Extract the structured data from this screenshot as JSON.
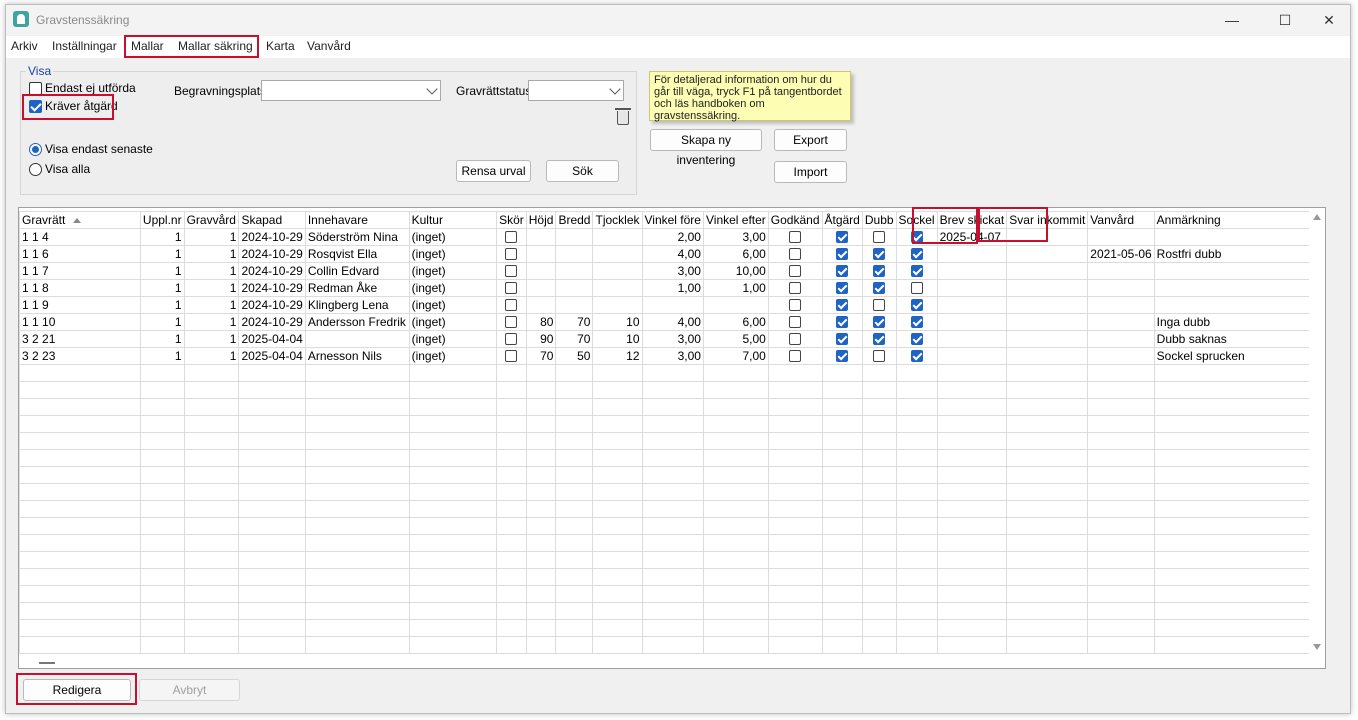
{
  "window": {
    "title": "Gravstenssäkring",
    "minimize": "—",
    "maximize": "☐",
    "close": "✕"
  },
  "menu": [
    "Arkiv",
    "Inställningar",
    "Mallar",
    "Mallar säkring",
    "Karta",
    "Vanvård"
  ],
  "filter": {
    "group_title": "Visa",
    "endast_ej_utforda": {
      "label": "Endast ej utförda",
      "checked": false
    },
    "kraver_atgard": {
      "label": "Kräver åtgärd",
      "checked": true
    },
    "visa_endast_senaste": {
      "label": "Visa endast senaste",
      "selected": true
    },
    "visa_alla": {
      "label": "Visa alla",
      "selected": false
    },
    "begravningsplats_label": "Begravningsplats:",
    "begravningsplats_value": "",
    "gravrattstatus_label": "Gravrättstatus:",
    "gravrattstatus_value": "",
    "rensa_urval": "Rensa urval",
    "sok": "Sök"
  },
  "help_note": "För detaljerad information om hur du går till väga, tryck F1 på tangentbordet och läs handboken om gravstenssäkring.",
  "actions": {
    "skapa_ny_inventering": "Skapa ny inventering",
    "export": "Export",
    "import": "Import"
  },
  "grid": {
    "columns": [
      "Gravrätt",
      "Uppl.nr",
      "Gravvård",
      "Skapad",
      "Innehavare",
      "Kultur",
      "Skör",
      "Höjd",
      "Bredd",
      "Tjocklek",
      "Vinkel före",
      "Vinkel efter",
      "Godkänd",
      "Åtgärd",
      "Dubb",
      "Sockel",
      "Brev skickat",
      "Svar inkommit",
      "Vanvård",
      "Anmärkning"
    ],
    "rows": [
      {
        "gravratt": "1 1  4",
        "uppl": "1",
        "gravvard": "1",
        "skapad": "2024-10-29",
        "innehavare": "Söderström Nina",
        "kultur": "(inget)",
        "skor": false,
        "hojd": "",
        "bredd": "",
        "tjocklek": "",
        "vinkel_fore": "2,00",
        "vinkel_efter": "3,00",
        "godkand": false,
        "atgard": true,
        "dubb": false,
        "sockel": true,
        "brev": "2025-04-07",
        "svar": "",
        "vanvard": "",
        "anm": ""
      },
      {
        "gravratt": "1 1  6",
        "uppl": "1",
        "gravvard": "1",
        "skapad": "2024-10-29",
        "innehavare": "Rosqvist Ella",
        "kultur": "(inget)",
        "skor": false,
        "hojd": "",
        "bredd": "",
        "tjocklek": "",
        "vinkel_fore": "4,00",
        "vinkel_efter": "6,00",
        "godkand": false,
        "atgard": true,
        "dubb": true,
        "sockel": true,
        "brev": "",
        "svar": "",
        "vanvard": "2021-05-06",
        "anm": "Rostfri dubb"
      },
      {
        "gravratt": "1 1  7",
        "uppl": "1",
        "gravvard": "1",
        "skapad": "2024-10-29",
        "innehavare": "Collin Edvard",
        "kultur": "(inget)",
        "skor": false,
        "hojd": "",
        "bredd": "",
        "tjocklek": "",
        "vinkel_fore": "3,00",
        "vinkel_efter": "10,00",
        "godkand": false,
        "atgard": true,
        "dubb": true,
        "sockel": true,
        "brev": "",
        "svar": "",
        "vanvard": "",
        "anm": ""
      },
      {
        "gravratt": "1 1  8",
        "uppl": "1",
        "gravvard": "1",
        "skapad": "2024-10-29",
        "innehavare": "Redman Åke",
        "kultur": "(inget)",
        "skor": false,
        "hojd": "",
        "bredd": "",
        "tjocklek": "",
        "vinkel_fore": "1,00",
        "vinkel_efter": "1,00",
        "godkand": false,
        "atgard": true,
        "dubb": true,
        "sockel": false,
        "brev": "",
        "svar": "",
        "vanvard": "",
        "anm": ""
      },
      {
        "gravratt": "1 1  9",
        "uppl": "1",
        "gravvard": "1",
        "skapad": "2024-10-29",
        "innehavare": "Klingberg Lena",
        "kultur": "(inget)",
        "skor": false,
        "hojd": "",
        "bredd": "",
        "tjocklek": "",
        "vinkel_fore": "",
        "vinkel_efter": "",
        "godkand": false,
        "atgard": true,
        "dubb": false,
        "sockel": true,
        "brev": "",
        "svar": "",
        "vanvard": "",
        "anm": ""
      },
      {
        "gravratt": "1 1  10",
        "uppl": "1",
        "gravvard": "1",
        "skapad": "2024-10-29",
        "innehavare": "Andersson Fredrik",
        "kultur": "(inget)",
        "skor": false,
        "hojd": "80",
        "bredd": "70",
        "tjocklek": "10",
        "vinkel_fore": "4,00",
        "vinkel_efter": "6,00",
        "godkand": false,
        "atgard": true,
        "dubb": true,
        "sockel": true,
        "brev": "",
        "svar": "",
        "vanvard": "",
        "anm": "Inga dubb"
      },
      {
        "gravratt": "3 2  21",
        "uppl": "1",
        "gravvard": "1",
        "skapad": "2025-04-04",
        "innehavare": "",
        "kultur": "(inget)",
        "skor": false,
        "hojd": "90",
        "bredd": "70",
        "tjocklek": "10",
        "vinkel_fore": "3,00",
        "vinkel_efter": "5,00",
        "godkand": false,
        "atgard": true,
        "dubb": true,
        "sockel": true,
        "brev": "",
        "svar": "",
        "vanvard": "",
        "anm": "Dubb saknas"
      },
      {
        "gravratt": "3 2  23",
        "uppl": "1",
        "gravvard": "1",
        "skapad": "2025-04-04",
        "innehavare": "Arnesson Nils",
        "kultur": "(inget)",
        "skor": false,
        "hojd": "70",
        "bredd": "50",
        "tjocklek": "12",
        "vinkel_fore": "3,00",
        "vinkel_efter": "7,00",
        "godkand": false,
        "atgard": true,
        "dubb": false,
        "sockel": true,
        "brev": "",
        "svar": "",
        "vanvard": "",
        "anm": "Sockel sprucken"
      }
    ]
  },
  "footer": {
    "redigera": "Redigera",
    "avbryt": "Avbryt"
  }
}
